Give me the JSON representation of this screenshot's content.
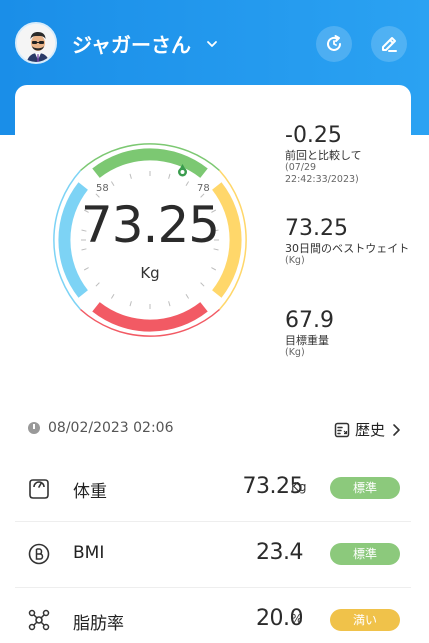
{
  "header": {
    "username": "ジャガーさん",
    "colors": {
      "header_start": "#1a8ee8",
      "header_end": "#2ba2f2"
    },
    "icons": [
      "avatar",
      "chevron-down-icon",
      "sync-icon",
      "edit-icon"
    ]
  },
  "gauge": {
    "weight": "73.25",
    "unit": "Kg",
    "range_low_label": "58",
    "range_high_label": "78",
    "colors": {
      "blue": "#7dd3f5",
      "green": "#7cc872",
      "yellow": "#ffd76a",
      "red": "#f25a64"
    }
  },
  "stats": [
    {
      "value": "-0.25",
      "label": "前回と比較して",
      "sub1": "(07/29",
      "sub2": "22:42:33/2023)"
    },
    {
      "value": "73.25",
      "label": "30日間のベストウェイト",
      "sub1": "(Kg)",
      "sub2": ""
    },
    {
      "value": "67.9",
      "label": "目標重量",
      "sub1": "(Kg)",
      "sub2": ""
    }
  ],
  "datebar": {
    "datetime": "08/02/2023 02:06"
  },
  "history": {
    "label": "歴史"
  },
  "metrics": [
    {
      "icon": "weight-icon",
      "name": "体重",
      "value": "73.25",
      "unit": "Kg",
      "badge": "標準",
      "badge_color": "#8cc97c"
    },
    {
      "icon": "bmi-icon",
      "name": "BMI",
      "value": "23.4",
      "unit": "",
      "badge": "標準",
      "badge_color": "#8cc97c"
    },
    {
      "icon": "body-fat-icon",
      "name": "脂肪率",
      "value": "20.0",
      "unit": "%",
      "badge": "満い",
      "badge_color": "#f0c24a"
    }
  ]
}
